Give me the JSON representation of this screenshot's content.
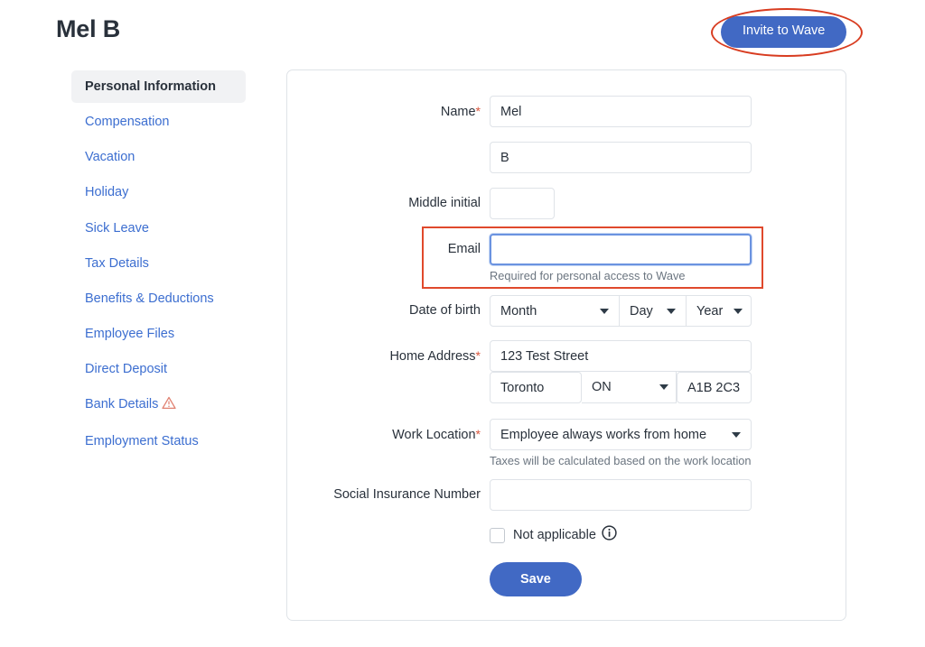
{
  "header": {
    "title": "Mel B",
    "invite_button": "Invite to Wave"
  },
  "sidebar": {
    "items": [
      {
        "label": "Personal Information",
        "active": true,
        "warning": false
      },
      {
        "label": "Compensation",
        "active": false,
        "warning": false
      },
      {
        "label": "Vacation",
        "active": false,
        "warning": false
      },
      {
        "label": "Holiday",
        "active": false,
        "warning": false
      },
      {
        "label": "Sick Leave",
        "active": false,
        "warning": false
      },
      {
        "label": "Tax Details",
        "active": false,
        "warning": false
      },
      {
        "label": "Benefits & Deductions",
        "active": false,
        "warning": false
      },
      {
        "label": "Employee Files",
        "active": false,
        "warning": false
      },
      {
        "label": "Direct Deposit",
        "active": false,
        "warning": false
      },
      {
        "label": "Bank Details",
        "active": false,
        "warning": true
      },
      {
        "label": "Employment Status",
        "active": false,
        "warning": false
      }
    ]
  },
  "form": {
    "name": {
      "label": "Name",
      "required_marker": "*",
      "first_value": "Mel",
      "last_value": "B"
    },
    "middle_initial": {
      "label": "Middle initial",
      "value": ""
    },
    "email": {
      "label": "Email",
      "value": "",
      "help": "Required for personal access to Wave",
      "focused": true,
      "highlighted": true
    },
    "date_of_birth": {
      "label": "Date of birth",
      "month": "Month",
      "day": "Day",
      "year": "Year"
    },
    "home_address": {
      "label": "Home Address",
      "required_marker": "*",
      "street": "123 Test Street",
      "city": "Toronto",
      "province": "ON",
      "postal": "A1B 2C3"
    },
    "work_location": {
      "label": "Work Location",
      "required_marker": "*",
      "value": "Employee always works from home",
      "help": "Taxes will be calculated based on the work location"
    },
    "social_insurance_number": {
      "label": "Social Insurance Number",
      "value": ""
    },
    "not_applicable": {
      "label": "Not applicable",
      "checked": false,
      "info_icon": "info-icon"
    },
    "save_button": "Save"
  },
  "annotations": {
    "invite_ellipse_color": "#d83c20",
    "email_box_color": "#e0492c"
  },
  "colors": {
    "primary_blue": "#4169c4",
    "link_blue": "#3c6ed0",
    "text_dark": "#29313b",
    "border_gray": "#dfe3e8",
    "active_bg": "#f1f2f4",
    "required_red": "#d8553c",
    "warning_orange": "#e08070"
  }
}
